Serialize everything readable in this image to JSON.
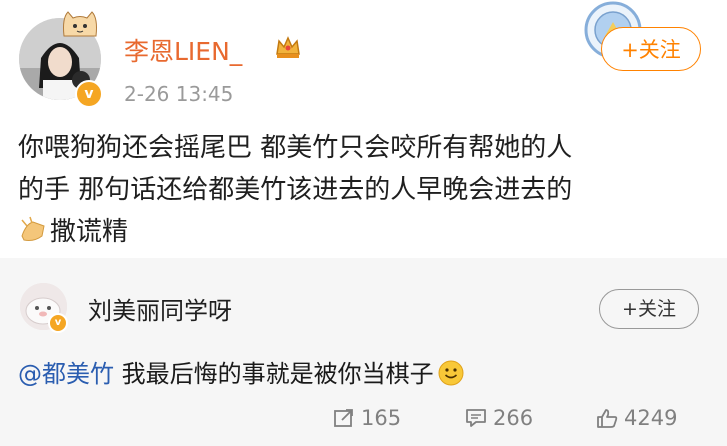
{
  "post": {
    "author": "李恩LIEN_",
    "timestamp": "2-26 13:45",
    "follow_label": "+关注",
    "content_lines": [
      "你喂狗狗还会摇尾巴 都美竹只会咬所有帮她的人",
      "的手 那句话还给都美竹该进去的人早晚会进去的",
      "撒谎精"
    ],
    "icons": [
      "cat-decoration-icon",
      "crown-icon",
      "verified-badge-icon",
      "club-crest-icon",
      "clap-emoji-icon"
    ],
    "colors": {
      "username": "#e8692f",
      "follow": "#ff8200",
      "badge": "#f5a623"
    }
  },
  "comment": {
    "author": "刘美丽同学呀",
    "follow_label": "+关注",
    "mention": "@都美竹",
    "text": " 我最后悔的事就是被你当棋子",
    "icons": [
      "smile-emoji-icon"
    ],
    "colors": {
      "mention": "#2a5db0",
      "background": "#f6f6f6"
    }
  },
  "actions": {
    "reposts": "165",
    "comments": "266",
    "likes": "4249",
    "icons": [
      "repost-icon",
      "comment-icon",
      "like-icon"
    ]
  }
}
